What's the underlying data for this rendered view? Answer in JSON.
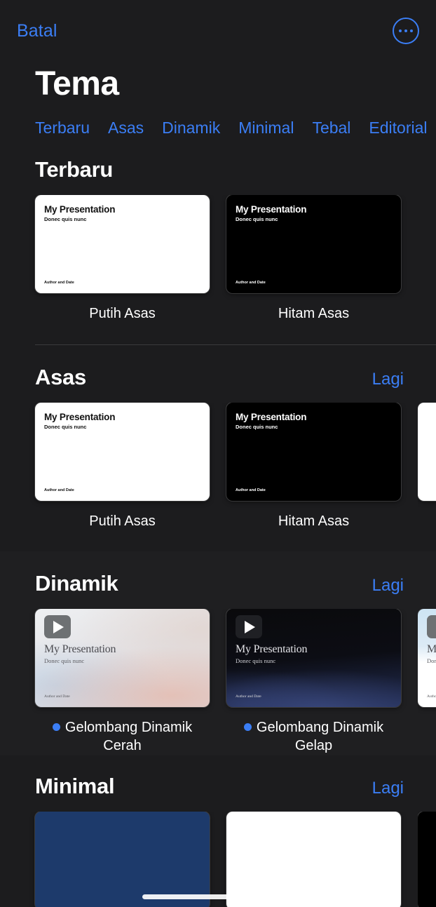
{
  "navbar": {
    "cancel_label": "Batal",
    "more_icon": "ellipsis-circle-icon"
  },
  "page_title": "Tema",
  "tabs": [
    {
      "label": "Terbaru"
    },
    {
      "label": "Asas"
    },
    {
      "label": "Dinamik"
    },
    {
      "label": "Minimal"
    },
    {
      "label": "Tebal"
    },
    {
      "label": "Editorial"
    }
  ],
  "slide_text": {
    "title": "My Presentation",
    "subtitle": "Donec quis nunc",
    "footer": "Author and Date"
  },
  "sections": [
    {
      "title": "Terbaru",
      "more_label": "",
      "cards": [
        {
          "label": "Putih Asas",
          "style": "white",
          "has_play": false,
          "has_dot": false
        },
        {
          "label": "Hitam Asas",
          "style": "black",
          "has_play": false,
          "has_dot": false
        }
      ]
    },
    {
      "title": "Asas",
      "more_label": "Lagi",
      "cards": [
        {
          "label": "Putih Asas",
          "style": "white",
          "has_play": false,
          "has_dot": false
        },
        {
          "label": "Hitam Asas",
          "style": "black",
          "has_play": false,
          "has_dot": false
        },
        {
          "label": "",
          "style": "plainwhite",
          "has_play": false,
          "has_dot": false
        }
      ]
    },
    {
      "title": "Dinamik",
      "more_label": "Lagi",
      "cards": [
        {
          "label": "Gelombang Dinamik Cerah",
          "style": "lightgrad",
          "has_play": true,
          "has_dot": true
        },
        {
          "label": "Gelombang Dinamik Gelap",
          "style": "darkgrad",
          "has_play": true,
          "has_dot": true
        },
        {
          "label": "",
          "style": "bluegrad",
          "has_play": true,
          "has_dot": false
        }
      ]
    },
    {
      "title": "Minimal",
      "more_label": "Lagi",
      "cards": [
        {
          "label": "",
          "style": "navy",
          "has_play": false,
          "has_dot": false
        },
        {
          "label": "",
          "style": "plainwhite",
          "has_play": false,
          "has_dot": false
        },
        {
          "label": "",
          "style": "black",
          "has_play": false,
          "has_dot": false
        }
      ]
    }
  ],
  "colors": {
    "accent": "#3b7ef5",
    "background": "#1c1c1e",
    "section_shaded": "#1f1f21",
    "text_primary": "#ffffff",
    "divider": "#3a3a3c"
  }
}
